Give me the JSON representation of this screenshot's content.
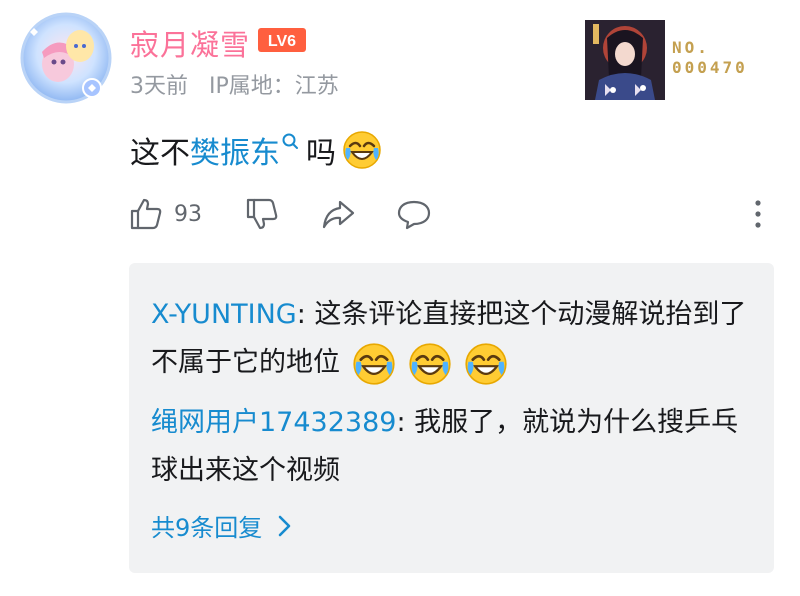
{
  "comment": {
    "username": "寂月凝雪",
    "level_badge": "LV6",
    "time": "3天前",
    "ip_location": "IP属地：江苏",
    "fan_badge_number": "NO.\n000470",
    "content_before": "这不",
    "content_link": "樊振东",
    "content_after": "吗",
    "likes": "93"
  },
  "replies": [
    {
      "author": "X-YUNTING",
      "text": ": 这条评论直接把这个动漫解说抬到了不属于它的地位"
    },
    {
      "author": "绳网用户17432389",
      "text": ": 我服了，就说为什么搜乒乓球出来这个视频"
    }
  ],
  "more_replies": "共9条回复",
  "colors": {
    "username": "#fb7299",
    "link": "#178bcf",
    "meta": "#9499a0",
    "reply_bg": "#f1f2f3"
  },
  "icons": [
    "like-icon",
    "dislike-icon",
    "share-icon",
    "reply-icon",
    "more-options-icon",
    "search-mini-icon",
    "laughing-cry-emoji",
    "chevron-right-icon"
  ]
}
